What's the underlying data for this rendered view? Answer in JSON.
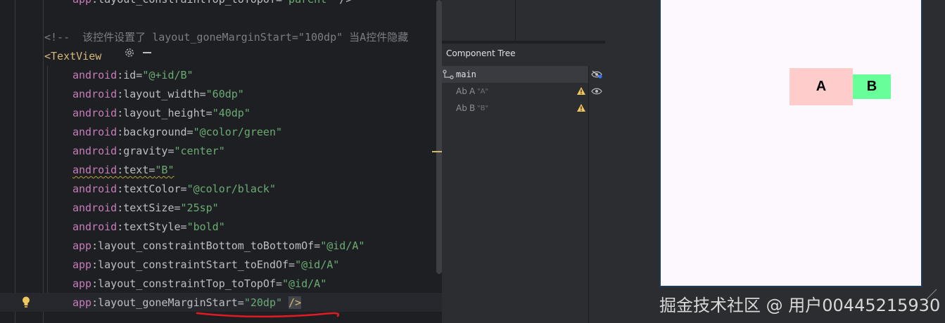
{
  "editor": {
    "lines": [
      {
        "parts": [
          {
            "cls": "c-ns",
            "t": "app"
          },
          {
            "cls": "c-attr",
            "t": ":layout_constraintTop_toTopOf="
          },
          {
            "cls": "c-str",
            "t": "\"parent\""
          },
          {
            "cls": "c-plain",
            "t": " />"
          }
        ]
      },
      {
        "parts": []
      },
      {
        "parts": [
          {
            "cls": "c-comment",
            "t": "<!--  该控件设置了 layout_goneMarginStart=\"100dp\" 当A控件隐藏"
          }
        ]
      },
      {
        "parts": [
          {
            "cls": "c-tag",
            "t": "<TextView"
          }
        ]
      },
      {
        "parts": [
          {
            "cls": "c-ns",
            "t": "android"
          },
          {
            "cls": "c-attr",
            "t": ":id="
          },
          {
            "cls": "c-str",
            "t": "\"@+id/B\""
          }
        ]
      },
      {
        "parts": [
          {
            "cls": "c-ns",
            "t": "android"
          },
          {
            "cls": "c-attr",
            "t": ":layout_width="
          },
          {
            "cls": "c-str",
            "t": "\"60dp\""
          }
        ]
      },
      {
        "parts": [
          {
            "cls": "c-ns",
            "t": "android"
          },
          {
            "cls": "c-attr",
            "t": ":layout_height="
          },
          {
            "cls": "c-str",
            "t": "\"40dp\""
          }
        ]
      },
      {
        "parts": [
          {
            "cls": "c-ns",
            "t": "android"
          },
          {
            "cls": "c-attr",
            "t": ":background="
          },
          {
            "cls": "c-str",
            "t": "\"@color/green\""
          }
        ]
      },
      {
        "parts": [
          {
            "cls": "c-ns",
            "t": "android"
          },
          {
            "cls": "c-attr",
            "t": ":gravity="
          },
          {
            "cls": "c-str",
            "t": "\"center\""
          }
        ]
      },
      {
        "parts": [
          {
            "cls": "c-ns squiggle",
            "t": "android"
          },
          {
            "cls": "c-attr squiggle",
            "t": ":text="
          },
          {
            "cls": "c-str squiggle",
            "t": "\"B\""
          }
        ]
      },
      {
        "parts": [
          {
            "cls": "c-ns",
            "t": "android"
          },
          {
            "cls": "c-attr",
            "t": ":textColor="
          },
          {
            "cls": "c-str",
            "t": "\"@color/black\""
          }
        ]
      },
      {
        "parts": [
          {
            "cls": "c-ns",
            "t": "android"
          },
          {
            "cls": "c-attr",
            "t": ":textSize="
          },
          {
            "cls": "c-str",
            "t": "\"25sp\""
          }
        ]
      },
      {
        "parts": [
          {
            "cls": "c-ns",
            "t": "android"
          },
          {
            "cls": "c-attr",
            "t": ":textStyle="
          },
          {
            "cls": "c-str",
            "t": "\"bold\""
          }
        ]
      },
      {
        "parts": [
          {
            "cls": "c-ns",
            "t": "app"
          },
          {
            "cls": "c-attr",
            "t": ":layout_constraintBottom_toBottomOf="
          },
          {
            "cls": "c-str",
            "t": "\"@id/A\""
          }
        ]
      },
      {
        "parts": [
          {
            "cls": "c-ns",
            "t": "app"
          },
          {
            "cls": "c-attr",
            "t": ":layout_constraintStart_toEndOf="
          },
          {
            "cls": "c-str",
            "t": "\"@id/A\""
          }
        ]
      },
      {
        "parts": [
          {
            "cls": "c-ns",
            "t": "app"
          },
          {
            "cls": "c-attr",
            "t": ":layout_constraintTop_toTopOf="
          },
          {
            "cls": "c-str",
            "t": "\"@id/A\""
          }
        ]
      },
      {
        "parts": [
          {
            "cls": "c-ns",
            "t": "app"
          },
          {
            "cls": "c-attr",
            "t": ":layout_goneMarginStart="
          },
          {
            "cls": "c-str",
            "t": "\"20dp\""
          },
          {
            "cls": "c-plain",
            "t": " "
          },
          {
            "cls": "c-tag tag-bracket-hl",
            "t": "/>"
          }
        ]
      }
    ]
  },
  "component_tree": {
    "title": "Component Tree",
    "root": {
      "label": "main"
    },
    "children": [
      {
        "prefix": "Ab",
        "name": "A",
        "text": "\"A\""
      },
      {
        "prefix": "Ab",
        "name": "B",
        "text": "\"B\""
      }
    ]
  },
  "preview": {
    "box_a_text": "A",
    "box_b_text": "B",
    "box_a_color": "#ffcccc",
    "box_b_color": "#66ff99"
  },
  "watermark": "掘金技术社区 @ 用户00445215930"
}
